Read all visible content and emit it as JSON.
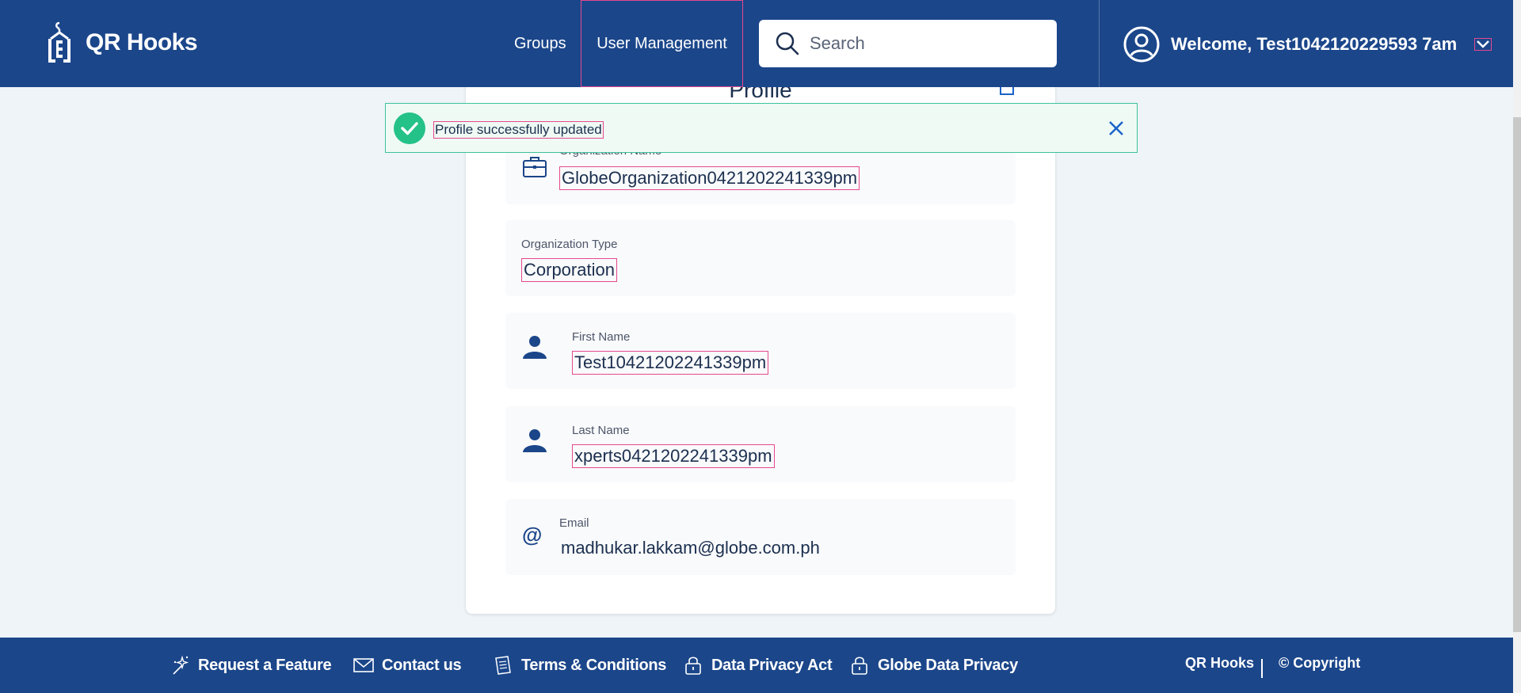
{
  "app": {
    "name": "QR Hooks"
  },
  "nav": {
    "groups": "Groups",
    "user_management": "User Management"
  },
  "search": {
    "placeholder": "Search"
  },
  "user": {
    "welcome": "Welcome, Test1042120229593 7am"
  },
  "profile": {
    "title": "Profile",
    "fields": {
      "org_name": {
        "label": "Organization Name",
        "value": "GlobeOrganization0421202241339pm"
      },
      "org_type": {
        "label": "Organization Type",
        "value": "Corporation"
      },
      "first_name": {
        "label": "First Name",
        "value": "Test10421202241339pm"
      },
      "last_name": {
        "label": "Last Name",
        "value": "xperts0421202241339pm"
      },
      "email": {
        "label": "Email",
        "value": "madhukar.lakkam@globe.com.ph"
      }
    }
  },
  "toast": {
    "message": "Profile successfully updated",
    "status_color": "#24c189"
  },
  "footer": {
    "request_feature": "Request a Feature",
    "contact": "Contact us",
    "terms": "Terms & Conditions",
    "data_privacy": "Data Privacy Act",
    "globe_privacy": "Globe Data Privacy",
    "brand": "QR Hooks",
    "copyright": "© Copyright"
  },
  "colors": {
    "primary": "#1b468a",
    "text": "#1b2f4f",
    "highlight": "#e6498f"
  }
}
